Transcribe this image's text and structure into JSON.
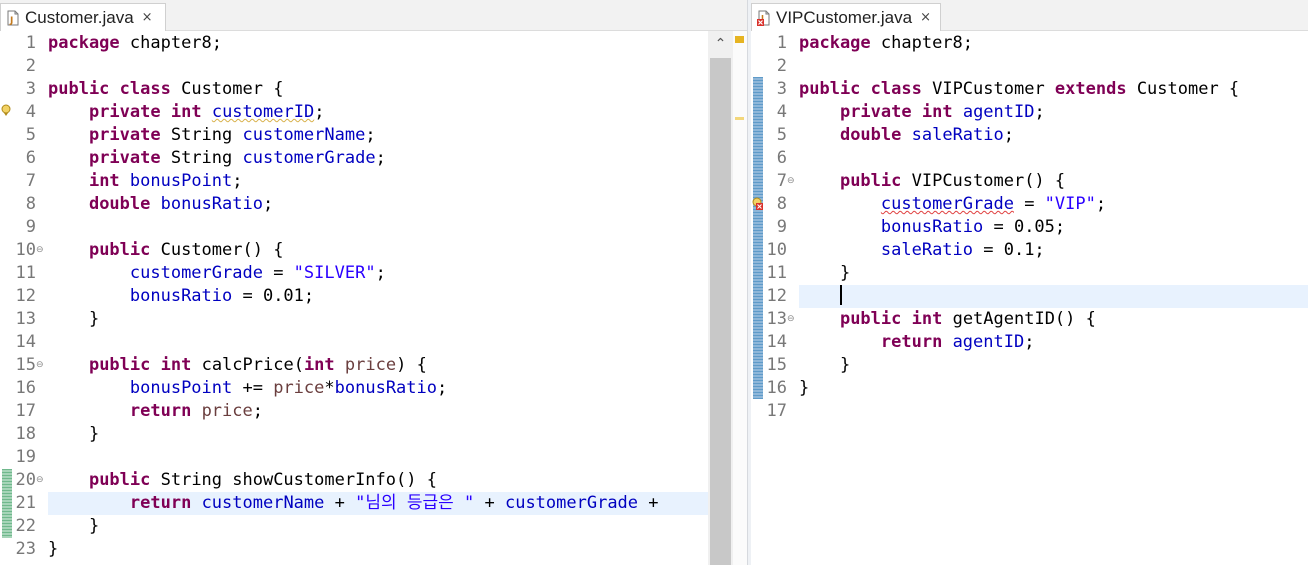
{
  "left_editor": {
    "tab": {
      "label": "Customer.java",
      "close": "×"
    },
    "lines": [
      {
        "no": "1",
        "tokens": [
          {
            "t": "package",
            "c": "kw"
          },
          {
            "t": " chapter8;"
          }
        ]
      },
      {
        "no": "2",
        "tokens": []
      },
      {
        "no": "3",
        "tokens": [
          {
            "t": "public",
            "c": "kw"
          },
          {
            "t": " "
          },
          {
            "t": "class",
            "c": "kw"
          },
          {
            "t": " Customer {"
          }
        ]
      },
      {
        "no": "4",
        "tokens": [
          {
            "t": "    "
          },
          {
            "t": "private",
            "c": "kw"
          },
          {
            "t": " "
          },
          {
            "t": "int",
            "c": "kw"
          },
          {
            "t": " "
          },
          {
            "t": "customerID",
            "c": "fld warn-ul"
          },
          {
            "t": ";"
          }
        ]
      },
      {
        "no": "5",
        "tokens": [
          {
            "t": "    "
          },
          {
            "t": "private",
            "c": "kw"
          },
          {
            "t": " String "
          },
          {
            "t": "customerName",
            "c": "fld"
          },
          {
            "t": ";"
          }
        ]
      },
      {
        "no": "6",
        "tokens": [
          {
            "t": "    "
          },
          {
            "t": "private",
            "c": "kw"
          },
          {
            "t": " String "
          },
          {
            "t": "customerGrade",
            "c": "fld"
          },
          {
            "t": ";"
          }
        ]
      },
      {
        "no": "7",
        "tokens": [
          {
            "t": "    "
          },
          {
            "t": "int",
            "c": "kw"
          },
          {
            "t": " "
          },
          {
            "t": "bonusPoint",
            "c": "fld"
          },
          {
            "t": ";"
          }
        ]
      },
      {
        "no": "8",
        "tokens": [
          {
            "t": "    "
          },
          {
            "t": "double",
            "c": "kw"
          },
          {
            "t": " "
          },
          {
            "t": "bonusRatio",
            "c": "fld"
          },
          {
            "t": ";"
          }
        ]
      },
      {
        "no": "9",
        "tokens": []
      },
      {
        "no": "10",
        "fold": true,
        "tokens": [
          {
            "t": "    "
          },
          {
            "t": "public",
            "c": "kw"
          },
          {
            "t": " Customer() {"
          }
        ]
      },
      {
        "no": "11",
        "tokens": [
          {
            "t": "        "
          },
          {
            "t": "customerGrade",
            "c": "fld"
          },
          {
            "t": " = "
          },
          {
            "t": "\"SILVER\"",
            "c": "str"
          },
          {
            "t": ";"
          }
        ]
      },
      {
        "no": "12",
        "tokens": [
          {
            "t": "        "
          },
          {
            "t": "bonusRatio",
            "c": "fld"
          },
          {
            "t": " = 0.01;"
          }
        ]
      },
      {
        "no": "13",
        "tokens": [
          {
            "t": "    }"
          }
        ]
      },
      {
        "no": "14",
        "tokens": []
      },
      {
        "no": "15",
        "fold": true,
        "tokens": [
          {
            "t": "    "
          },
          {
            "t": "public",
            "c": "kw"
          },
          {
            "t": " "
          },
          {
            "t": "int",
            "c": "kw"
          },
          {
            "t": " calcPrice("
          },
          {
            "t": "int",
            "c": "kw"
          },
          {
            "t": " "
          },
          {
            "t": "price",
            "c": "par"
          },
          {
            "t": ") {"
          }
        ]
      },
      {
        "no": "16",
        "tokens": [
          {
            "t": "        "
          },
          {
            "t": "bonusPoint",
            "c": "fld"
          },
          {
            "t": " += "
          },
          {
            "t": "price",
            "c": "par"
          },
          {
            "t": "*"
          },
          {
            "t": "bonusRatio",
            "c": "fld"
          },
          {
            "t": ";"
          }
        ]
      },
      {
        "no": "17",
        "tokens": [
          {
            "t": "        "
          },
          {
            "t": "return",
            "c": "kw"
          },
          {
            "t": " "
          },
          {
            "t": "price",
            "c": "par"
          },
          {
            "t": ";"
          }
        ]
      },
      {
        "no": "18",
        "tokens": [
          {
            "t": "    }"
          }
        ]
      },
      {
        "no": "19",
        "tokens": []
      },
      {
        "no": "20",
        "fold": true,
        "tokens": [
          {
            "t": "    "
          },
          {
            "t": "public",
            "c": "kw"
          },
          {
            "t": " String showCustomerInfo() {"
          }
        ]
      },
      {
        "no": "21",
        "current": true,
        "tokens": [
          {
            "t": "        "
          },
          {
            "t": "return",
            "c": "kw"
          },
          {
            "t": " "
          },
          {
            "t": "customerName",
            "c": "fld"
          },
          {
            "t": " + "
          },
          {
            "t": "\"님의 등급은 \"",
            "c": "str"
          },
          {
            "t": " + "
          },
          {
            "t": "customerGrade",
            "c": "fld"
          },
          {
            "t": " +"
          }
        ]
      },
      {
        "no": "22",
        "tokens": [
          {
            "t": "    }"
          }
        ]
      },
      {
        "no": "23",
        "tokens": [
          {
            "t": "}"
          }
        ]
      }
    ]
  },
  "right_editor": {
    "tab": {
      "label": "VIPCustomer.java",
      "close": "×"
    },
    "lines": [
      {
        "no": "1",
        "tokens": [
          {
            "t": "package",
            "c": "kw"
          },
          {
            "t": " chapter8;"
          }
        ]
      },
      {
        "no": "2",
        "tokens": []
      },
      {
        "no": "3",
        "tokens": [
          {
            "t": "public",
            "c": "kw"
          },
          {
            "t": " "
          },
          {
            "t": "class",
            "c": "kw"
          },
          {
            "t": " VIPCustomer "
          },
          {
            "t": "extends",
            "c": "kw"
          },
          {
            "t": " Customer {"
          }
        ]
      },
      {
        "no": "4",
        "tokens": [
          {
            "t": "    "
          },
          {
            "t": "private",
            "c": "kw"
          },
          {
            "t": " "
          },
          {
            "t": "int",
            "c": "kw"
          },
          {
            "t": " "
          },
          {
            "t": "agentID",
            "c": "fld"
          },
          {
            "t": ";"
          }
        ]
      },
      {
        "no": "5",
        "tokens": [
          {
            "t": "    "
          },
          {
            "t": "double",
            "c": "kw"
          },
          {
            "t": " "
          },
          {
            "t": "saleRatio",
            "c": "fld"
          },
          {
            "t": ";"
          }
        ]
      },
      {
        "no": "6",
        "tokens": []
      },
      {
        "no": "7",
        "fold": true,
        "tokens": [
          {
            "t": "    "
          },
          {
            "t": "public",
            "c": "kw"
          },
          {
            "t": " VIPCustomer() {"
          }
        ]
      },
      {
        "no": "8",
        "tokens": [
          {
            "t": "        "
          },
          {
            "t": "customerGrade",
            "c": "fld err-ul"
          },
          {
            "t": " = "
          },
          {
            "t": "\"VIP\"",
            "c": "str"
          },
          {
            "t": ";"
          }
        ]
      },
      {
        "no": "9",
        "tokens": [
          {
            "t": "        "
          },
          {
            "t": "bonusRatio",
            "c": "fld"
          },
          {
            "t": " = 0.05;"
          }
        ]
      },
      {
        "no": "10",
        "tokens": [
          {
            "t": "        "
          },
          {
            "t": "saleRatio",
            "c": "fld"
          },
          {
            "t": " = 0.1;"
          }
        ]
      },
      {
        "no": "11",
        "tokens": [
          {
            "t": "    }"
          }
        ]
      },
      {
        "no": "12",
        "current": true,
        "caret": true,
        "tokens": [
          {
            "t": "    "
          }
        ]
      },
      {
        "no": "13",
        "fold": true,
        "tokens": [
          {
            "t": "    "
          },
          {
            "t": "public",
            "c": "kw"
          },
          {
            "t": " "
          },
          {
            "t": "int",
            "c": "kw"
          },
          {
            "t": " getAgentID() {"
          }
        ]
      },
      {
        "no": "14",
        "tokens": [
          {
            "t": "        "
          },
          {
            "t": "return",
            "c": "kw"
          },
          {
            "t": " "
          },
          {
            "t": "agentID",
            "c": "fld"
          },
          {
            "t": ";"
          }
        ]
      },
      {
        "no": "15",
        "tokens": [
          {
            "t": "    }"
          }
        ]
      },
      {
        "no": "16",
        "tokens": [
          {
            "t": "}"
          }
        ]
      },
      {
        "no": "17",
        "tokens": []
      }
    ]
  },
  "icons": {
    "java_file": "java-file-icon",
    "java_file_error": "java-file-error-icon",
    "warning": "warning-marker-icon",
    "error": "error-marker-icon",
    "fold": "fold-collapse-icon"
  },
  "colors": {
    "keyword": "#7f0055",
    "field": "#0000c0",
    "string": "#2a00ff",
    "parameter": "#6a3e3e",
    "current_line": "#e8f2fe"
  }
}
